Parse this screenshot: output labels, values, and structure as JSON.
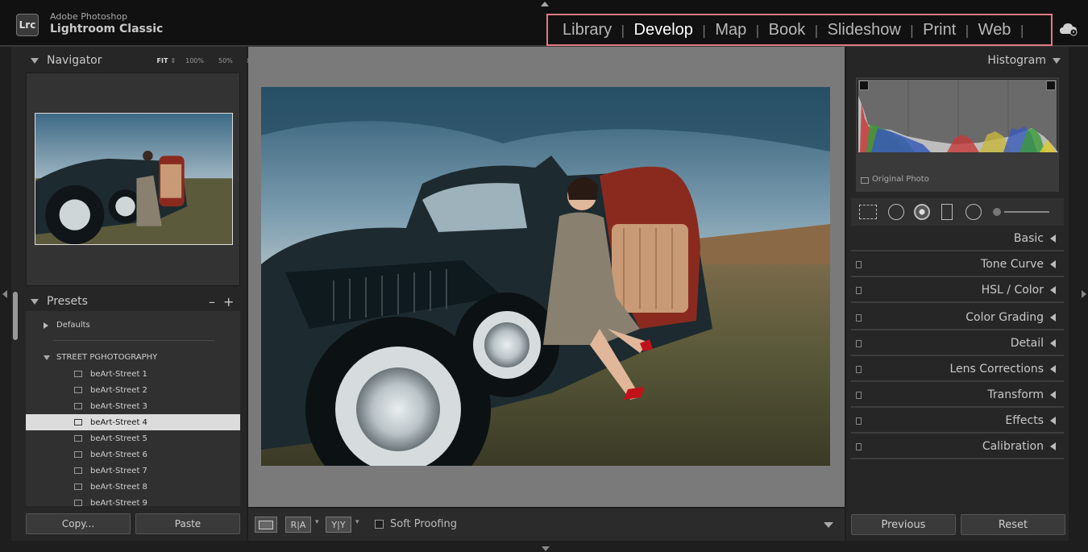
{
  "app": {
    "brand_line1": "Adobe Photoshop",
    "brand_line2": "Lightroom Classic",
    "logo_text": "Lrc"
  },
  "modules": [
    "Library",
    "Develop",
    "Map",
    "Book",
    "Slideshow",
    "Print",
    "Web"
  ],
  "active_module": "Develop",
  "navigator": {
    "title": "Navigator",
    "zoom_fit": "FIT",
    "zoom_100": "100%",
    "zoom_50": "50%"
  },
  "presets": {
    "title": "Presets",
    "minus": "–",
    "plus": "+",
    "defaults": "Defaults",
    "group": "STREET PGHOTOGRAPHY",
    "items": [
      "beArt-Street 1",
      "beArt-Street 2",
      "beArt-Street 3",
      "beArt-Street 4",
      "beArt-Street 5",
      "beArt-Street 6",
      "beArt-Street 7",
      "beArt-Street 8",
      "beArt-Street 9"
    ],
    "selected": "beArt-Street 4"
  },
  "left_buttons": {
    "copy": "Copy...",
    "paste": "Paste"
  },
  "toolbar": {
    "ra": "R|A",
    "yy": "Y|Y",
    "soft_proofing": "Soft Proofing"
  },
  "histogram": {
    "title": "Histogram",
    "original_photo": "Original Photo"
  },
  "sections": [
    "Basic",
    "Tone Curve",
    "HSL / Color",
    "Color Grading",
    "Detail",
    "Lens Corrections",
    "Transform",
    "Effects",
    "Calibration"
  ],
  "right_buttons": {
    "previous": "Previous",
    "reset": "Reset"
  },
  "colors": {
    "highlight": "#e07a84",
    "sky": "#5d8aa0",
    "grass": "#5b5a3a",
    "car": "#1d2a2f",
    "door_interior": "#c89a76",
    "dress": "#8a8070"
  }
}
